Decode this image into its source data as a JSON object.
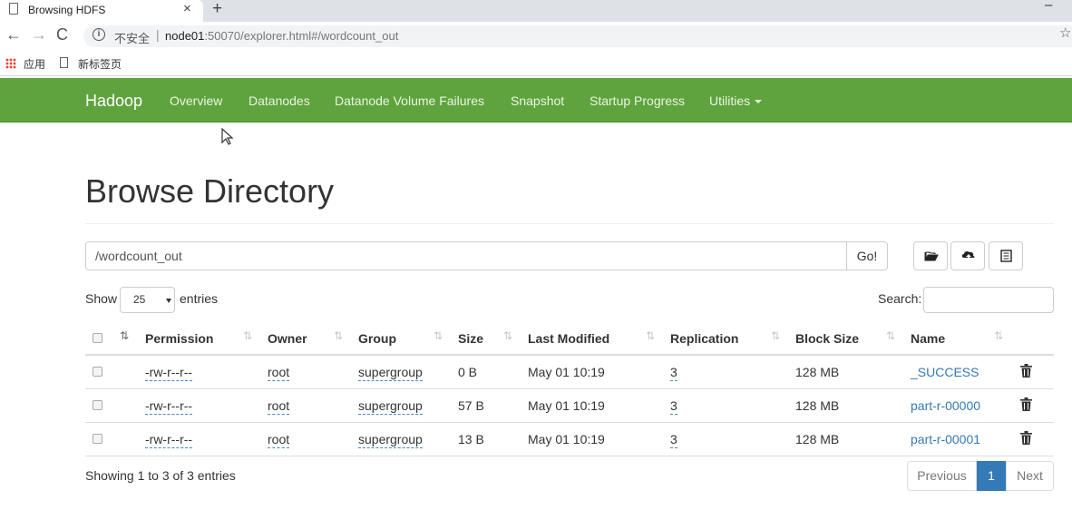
{
  "browser": {
    "tab_title": "Browsing HDFS",
    "tab_close": "×",
    "new_tab": "+",
    "minimize": "–",
    "security_label": "不安全",
    "url_host": "node01",
    "url_rest": ":50070/explorer.html#/wordcount_out",
    "bookmarks": {
      "apps": "应用",
      "new_tab_page": "新标签页"
    }
  },
  "navbar": {
    "brand": "Hadoop",
    "links": [
      "Overview",
      "Datanodes",
      "Datanode Volume Failures",
      "Snapshot",
      "Startup Progress",
      "Utilities"
    ]
  },
  "page": {
    "title": "Browse Directory",
    "path_value": "/wordcount_out",
    "go_label": "Go!",
    "show_label": "Show",
    "entries_value": "25",
    "entries_label": "entries",
    "search_label": "Search:"
  },
  "table": {
    "columns": [
      "Permission",
      "Owner",
      "Group",
      "Size",
      "Last Modified",
      "Replication",
      "Block Size",
      "Name"
    ],
    "rows": [
      {
        "permission": "-rw-r--r--",
        "owner": "root",
        "group": "supergroup",
        "size": "0 B",
        "modified": "May 01 10:19",
        "replication": "3",
        "block_size": "128 MB",
        "name": "_SUCCESS"
      },
      {
        "permission": "-rw-r--r--",
        "owner": "root",
        "group": "supergroup",
        "size": "57 B",
        "modified": "May 01 10:19",
        "replication": "3",
        "block_size": "128 MB",
        "name": "part-r-00000"
      },
      {
        "permission": "-rw-r--r--",
        "owner": "root",
        "group": "supergroup",
        "size": "13 B",
        "modified": "May 01 10:19",
        "replication": "3",
        "block_size": "128 MB",
        "name": "part-r-00001"
      }
    ]
  },
  "footer": {
    "info": "Showing 1 to 3 of 3 entries",
    "previous": "Previous",
    "current_page": "1",
    "next": "Next"
  },
  "colors": {
    "navbar": "#5fa33e",
    "link": "#337ab7",
    "active_page": "#337ab7"
  }
}
